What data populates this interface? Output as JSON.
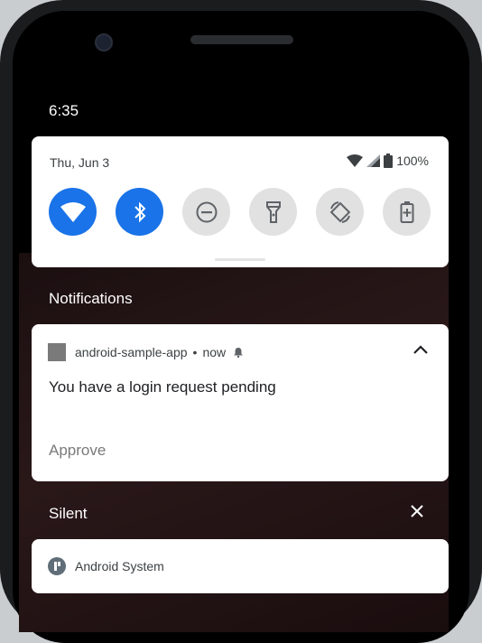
{
  "status_bar": {
    "time": "6:35"
  },
  "quick_settings": {
    "date": "Thu, Jun 3",
    "battery": "100%",
    "tiles": [
      {
        "icon": "wifi-icon",
        "state": "on"
      },
      {
        "icon": "bluetooth-icon",
        "state": "on"
      },
      {
        "icon": "do-not-disturb-icon",
        "state": "off"
      },
      {
        "icon": "flashlight-icon",
        "state": "off"
      },
      {
        "icon": "auto-rotate-icon",
        "state": "off"
      },
      {
        "icon": "battery-saver-icon",
        "state": "off"
      }
    ]
  },
  "notifications": {
    "section_title": "Notifications",
    "item": {
      "app_name": "android-sample-app",
      "time": "now",
      "message": "You have a login request pending",
      "action": "Approve"
    }
  },
  "silent": {
    "section_title": "Silent",
    "item": {
      "app_name": "Android System"
    }
  },
  "colors": {
    "accent": "#1a73e8",
    "tile_off": "#e1e1e1"
  }
}
